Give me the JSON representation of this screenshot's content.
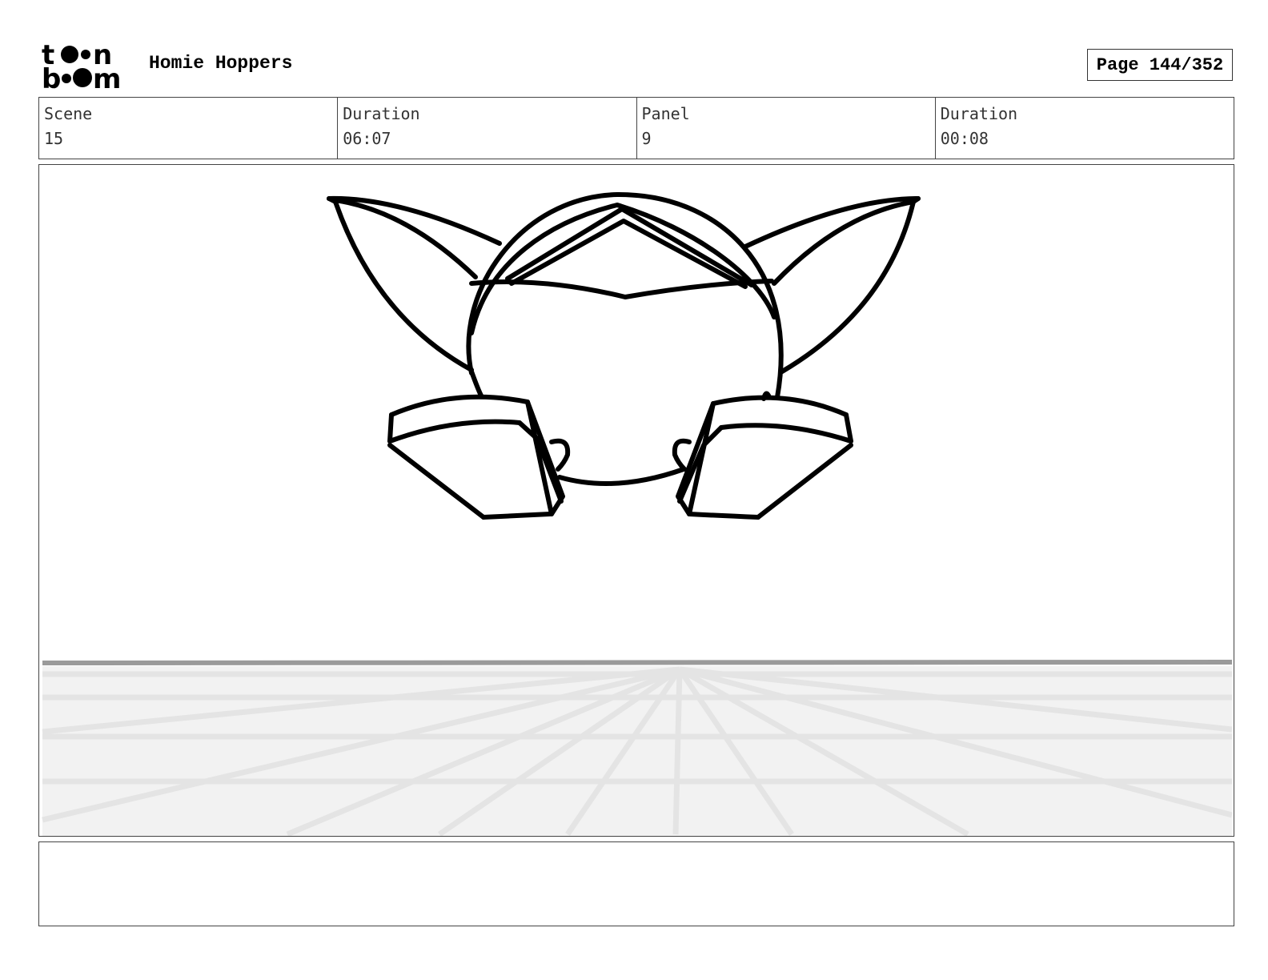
{
  "header": {
    "logo_top": "toon",
    "logo_bottom": "boom",
    "project_title": "Homie Hoppers",
    "page_label": "Page 144/352"
  },
  "info": {
    "scene_label": "Scene",
    "scene_value": "15",
    "scene_duration_label": "Duration",
    "scene_duration_value": "06:07",
    "panel_label": "Panel",
    "panel_value": "9",
    "panel_duration_label": "Duration",
    "panel_duration_value": "00:08"
  },
  "colors": {
    "ink": "#000000",
    "floor_fill": "#f2f2f2",
    "floor_grid": "#e4e4e4",
    "horizon": "#9a9a9a"
  },
  "notes": {
    "text": ""
  }
}
